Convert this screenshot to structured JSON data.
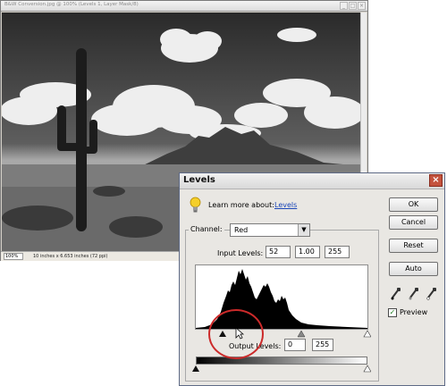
{
  "document_window": {
    "title": "B&W Conversion.jpg @ 100% (Levels 1, Layer Mask/8)",
    "status_zoom": "100%",
    "status_info": "10 inches x 6.653 inches (72 ppi)",
    "controls": [
      "_",
      "□",
      "×"
    ]
  },
  "levels_dialog": {
    "title": "Levels",
    "close_label": "×",
    "learn_more_text": "Learn more about:",
    "learn_more_link": "Levels",
    "channel_label": "Channel:",
    "channel_value": "Red",
    "input_levels_label": "Input Levels:",
    "input_black": "52",
    "input_gamma": "1.00",
    "input_white": "255",
    "output_levels_label": "Output Levels:",
    "output_black": "0",
    "output_white": "255",
    "buttons": {
      "ok": "OK",
      "cancel": "Cancel",
      "reset": "Reset",
      "auto": "Auto"
    },
    "preview_label": "Preview",
    "preview_checked": "✓",
    "icons": [
      "lightbulb-icon",
      "black-eyedropper-icon",
      "gray-eyedropper-icon",
      "white-eyedropper-icon"
    ],
    "highlight_color": "#cc2a2a"
  }
}
